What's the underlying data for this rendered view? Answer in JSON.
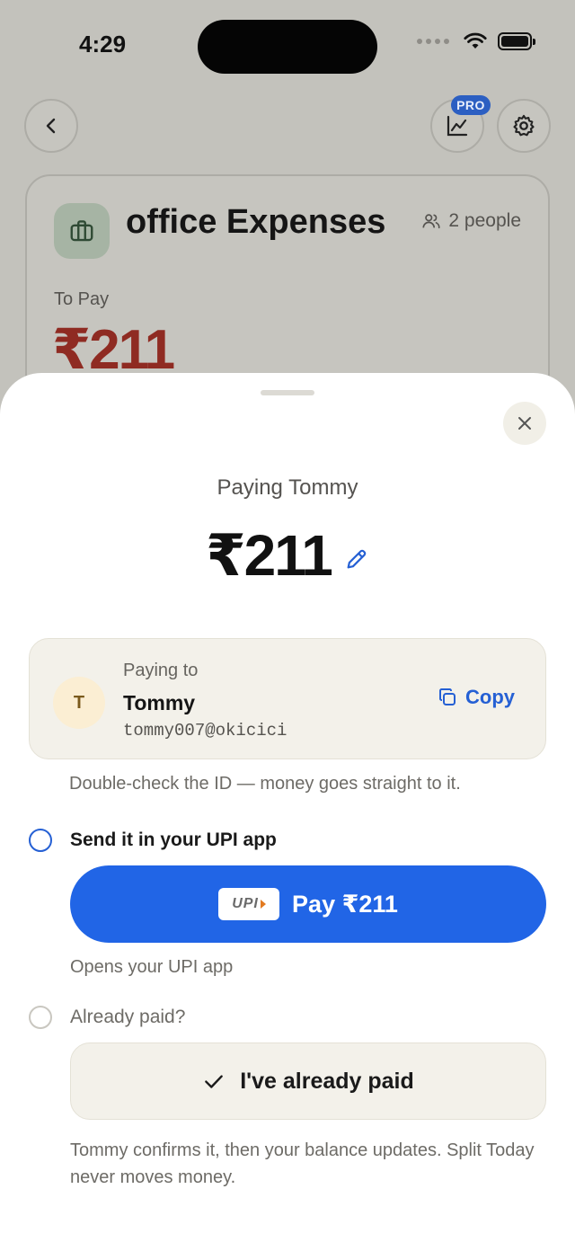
{
  "status_bar": {
    "time": "4:29"
  },
  "background": {
    "pro_badge": "PRO",
    "group": {
      "title": "office Expenses",
      "people": "2 people",
      "to_pay_label": "To Pay",
      "to_pay_amount": "₹211",
      "amount_color": "#8f2b22"
    }
  },
  "sheet": {
    "title": "Paying Tommy",
    "amount": "₹211",
    "payee": {
      "label": "Paying to",
      "initial": "T",
      "name": "Tommy",
      "upi_id": "tommy007@okicici",
      "copy_label": "Copy"
    },
    "warning": "Double-check the ID — money goes straight to it.",
    "option_upi": {
      "label": "Send it in your UPI app",
      "upi_logo_text": "UPI",
      "button_label": "Pay ₹211",
      "note": "Opens your UPI app"
    },
    "option_paid": {
      "label": "Already paid?",
      "button_label": "I've already paid"
    },
    "footnote": "Tommy confirms it, then your balance updates. Split Today never moves money."
  },
  "colors": {
    "accent": "#2165e6",
    "link": "#2560d4"
  },
  "icons": [
    "back-icon",
    "chart-icon",
    "gear-icon",
    "briefcase-icon",
    "people-icon",
    "close-icon",
    "pencil-icon",
    "copy-icon",
    "check-icon",
    "wifi-icon",
    "battery-icon"
  ]
}
